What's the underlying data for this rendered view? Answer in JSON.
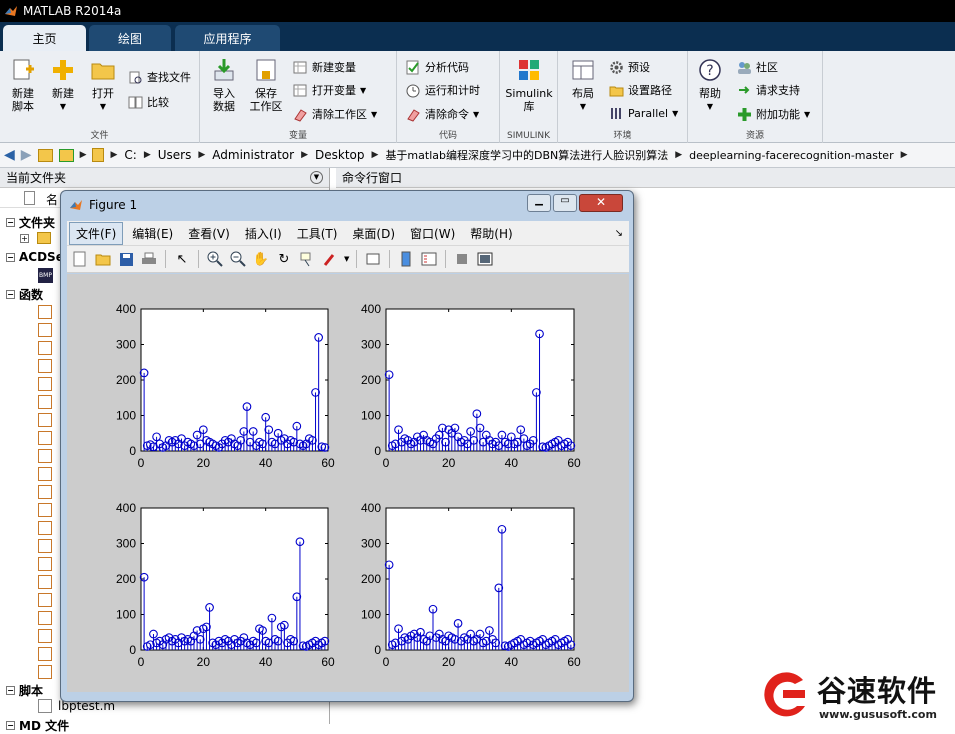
{
  "app": {
    "title": "MATLAB R2014a"
  },
  "tabs": [
    {
      "label": "主页",
      "active": true
    },
    {
      "label": "绘图",
      "active": false
    },
    {
      "label": "应用程序",
      "active": false
    }
  ],
  "ribbon": {
    "file": {
      "label": "文件",
      "new_script": "新建\n脚本",
      "new": "新建",
      "open": "打开",
      "find_files": "查找文件",
      "compare": "比较"
    },
    "variable": {
      "label": "变量",
      "import": "导入\n数据",
      "save_ws": "保存\n工作区",
      "new_var": "新建变量",
      "open_var": "打开变量",
      "clear_ws": "清除工作区"
    },
    "code": {
      "label": "代码",
      "analyze": "分析代码",
      "run_time": "运行和计时",
      "clear_cmd": "清除命令"
    },
    "simulink": {
      "label": "SIMULINK",
      "lib": "Simulink\n库"
    },
    "env": {
      "label": "环境",
      "layout": "布局",
      "prefs": "预设",
      "set_path": "设置路径",
      "parallel": "Parallel"
    },
    "resources": {
      "label": "资源",
      "help": "帮助",
      "community": "社区",
      "support": "请求支持",
      "addons": "附加功能"
    }
  },
  "address": {
    "crumbs": [
      "C:",
      "Users",
      "Administrator",
      "Desktop",
      "基于matlab编程深度学习中的DBN算法进行人脸识别算法",
      "deeplearning-facerecognition-master"
    ]
  },
  "left_panel": {
    "title": "当前文件夹",
    "col_name": "名",
    "sections": [
      "文件夹",
      "ACDSe",
      "函数",
      "脚本",
      "MD 文件"
    ],
    "script_file": "lbptest.m"
  },
  "cmd_panel": {
    "title": "命令行窗口"
  },
  "figure": {
    "title": "Figure 1",
    "menu": [
      "文件(F)",
      "编辑(E)",
      "查看(V)",
      "插入(I)",
      "工具(T)",
      "桌面(D)",
      "窗口(W)",
      "帮助(H)"
    ]
  },
  "watermark": {
    "brand": "谷速软件",
    "url": "www.gususoft.com"
  },
  "colors": {
    "stem": "#0000cc",
    "tab_bg": "#0b2e50",
    "tab_active": "#e8eef5",
    "plot_bg": "#cccccc"
  },
  "chart_data": [
    {
      "type": "stem",
      "x": [
        1,
        2,
        3,
        4,
        5,
        6,
        7,
        8,
        9,
        10,
        11,
        12,
        13,
        14,
        15,
        16,
        17,
        18,
        19,
        20,
        21,
        22,
        23,
        24,
        25,
        26,
        27,
        28,
        29,
        30,
        31,
        32,
        33,
        34,
        35,
        36,
        37,
        38,
        39,
        40,
        41,
        42,
        43,
        44,
        45,
        46,
        47,
        48,
        49,
        50,
        51,
        52,
        53,
        54,
        55,
        56,
        57,
        58,
        59
      ],
      "values": [
        220,
        15,
        18,
        12,
        40,
        20,
        10,
        15,
        30,
        25,
        30,
        20,
        35,
        15,
        25,
        20,
        15,
        45,
        20,
        60,
        30,
        25,
        20,
        15,
        10,
        20,
        30,
        25,
        35,
        20,
        15,
        30,
        55,
        125,
        25,
        55,
        15,
        25,
        20,
        95,
        60,
        25,
        20,
        50,
        30,
        35,
        20,
        30,
        25,
        70,
        20,
        15,
        20,
        35,
        30,
        165,
        320,
        12,
        10
      ],
      "xlim": [
        0,
        60
      ],
      "ylim": [
        0,
        400
      ],
      "xticks": [
        0,
        20,
        40,
        60
      ],
      "yticks": [
        0,
        100,
        200,
        300,
        400
      ]
    },
    {
      "type": "stem",
      "x": [
        1,
        2,
        3,
        4,
        5,
        6,
        7,
        8,
        9,
        10,
        11,
        12,
        13,
        14,
        15,
        16,
        17,
        18,
        19,
        20,
        21,
        22,
        23,
        24,
        25,
        26,
        27,
        28,
        29,
        30,
        31,
        32,
        33,
        34,
        35,
        36,
        37,
        38,
        39,
        40,
        41,
        42,
        43,
        44,
        45,
        46,
        47,
        48,
        49,
        50,
        51,
        52,
        53,
        54,
        55,
        56,
        57,
        58,
        59
      ],
      "values": [
        215,
        15,
        20,
        60,
        25,
        35,
        30,
        20,
        25,
        40,
        30,
        45,
        30,
        25,
        20,
        35,
        45,
        65,
        25,
        60,
        50,
        65,
        40,
        25,
        30,
        20,
        55,
        30,
        105,
        65,
        25,
        45,
        30,
        20,
        25,
        15,
        45,
        25,
        20,
        40,
        20,
        25,
        60,
        35,
        15,
        20,
        30,
        165,
        330,
        12,
        10,
        15,
        20,
        25,
        30,
        15,
        20,
        25,
        15
      ],
      "xlim": [
        0,
        60
      ],
      "ylim": [
        0,
        400
      ],
      "xticks": [
        0,
        20,
        40,
        60
      ],
      "yticks": [
        0,
        100,
        200,
        300,
        400
      ]
    },
    {
      "type": "stem",
      "x": [
        1,
        2,
        3,
        4,
        5,
        6,
        7,
        8,
        9,
        10,
        11,
        12,
        13,
        14,
        15,
        16,
        17,
        18,
        19,
        20,
        21,
        22,
        23,
        24,
        25,
        26,
        27,
        28,
        29,
        30,
        31,
        32,
        33,
        34,
        35,
        36,
        37,
        38,
        39,
        40,
        41,
        42,
        43,
        44,
        45,
        46,
        47,
        48,
        49,
        50,
        51,
        52,
        53,
        54,
        55,
        56,
        57,
        58,
        59
      ],
      "values": [
        205,
        10,
        15,
        45,
        20,
        25,
        15,
        30,
        35,
        25,
        30,
        20,
        35,
        25,
        30,
        25,
        40,
        55,
        30,
        60,
        65,
        120,
        20,
        15,
        25,
        20,
        30,
        25,
        15,
        30,
        20,
        25,
        35,
        20,
        15,
        25,
        20,
        60,
        55,
        25,
        20,
        90,
        30,
        25,
        65,
        70,
        20,
        30,
        25,
        150,
        305,
        12,
        10,
        15,
        20,
        25,
        15,
        20,
        25
      ],
      "xlim": [
        0,
        60
      ],
      "ylim": [
        0,
        400
      ],
      "xticks": [
        0,
        20,
        40,
        60
      ],
      "yticks": [
        0,
        100,
        200,
        300,
        400
      ]
    },
    {
      "type": "stem",
      "x": [
        1,
        2,
        3,
        4,
        5,
        6,
        7,
        8,
        9,
        10,
        11,
        12,
        13,
        14,
        15,
        16,
        17,
        18,
        19,
        20,
        21,
        22,
        23,
        24,
        25,
        26,
        27,
        28,
        29,
        30,
        31,
        32,
        33,
        34,
        35,
        36,
        37,
        38,
        39,
        40,
        41,
        42,
        43,
        44,
        45,
        46,
        47,
        48,
        49,
        50,
        51,
        52,
        53,
        54,
        55,
        56,
        57,
        58,
        59
      ],
      "values": [
        240,
        15,
        20,
        60,
        25,
        35,
        30,
        40,
        45,
        35,
        50,
        30,
        25,
        40,
        115,
        35,
        45,
        30,
        25,
        40,
        35,
        30,
        75,
        25,
        35,
        30,
        45,
        25,
        30,
        45,
        20,
        25,
        55,
        30,
        20,
        175,
        340,
        12,
        10,
        15,
        20,
        25,
        30,
        15,
        20,
        25,
        15,
        20,
        25,
        30,
        15,
        20,
        25,
        30,
        15,
        20,
        25,
        30,
        15
      ],
      "xlim": [
        0,
        60
      ],
      "ylim": [
        0,
        400
      ],
      "xticks": [
        0,
        20,
        40,
        60
      ],
      "yticks": [
        0,
        100,
        200,
        300,
        400
      ]
    }
  ]
}
